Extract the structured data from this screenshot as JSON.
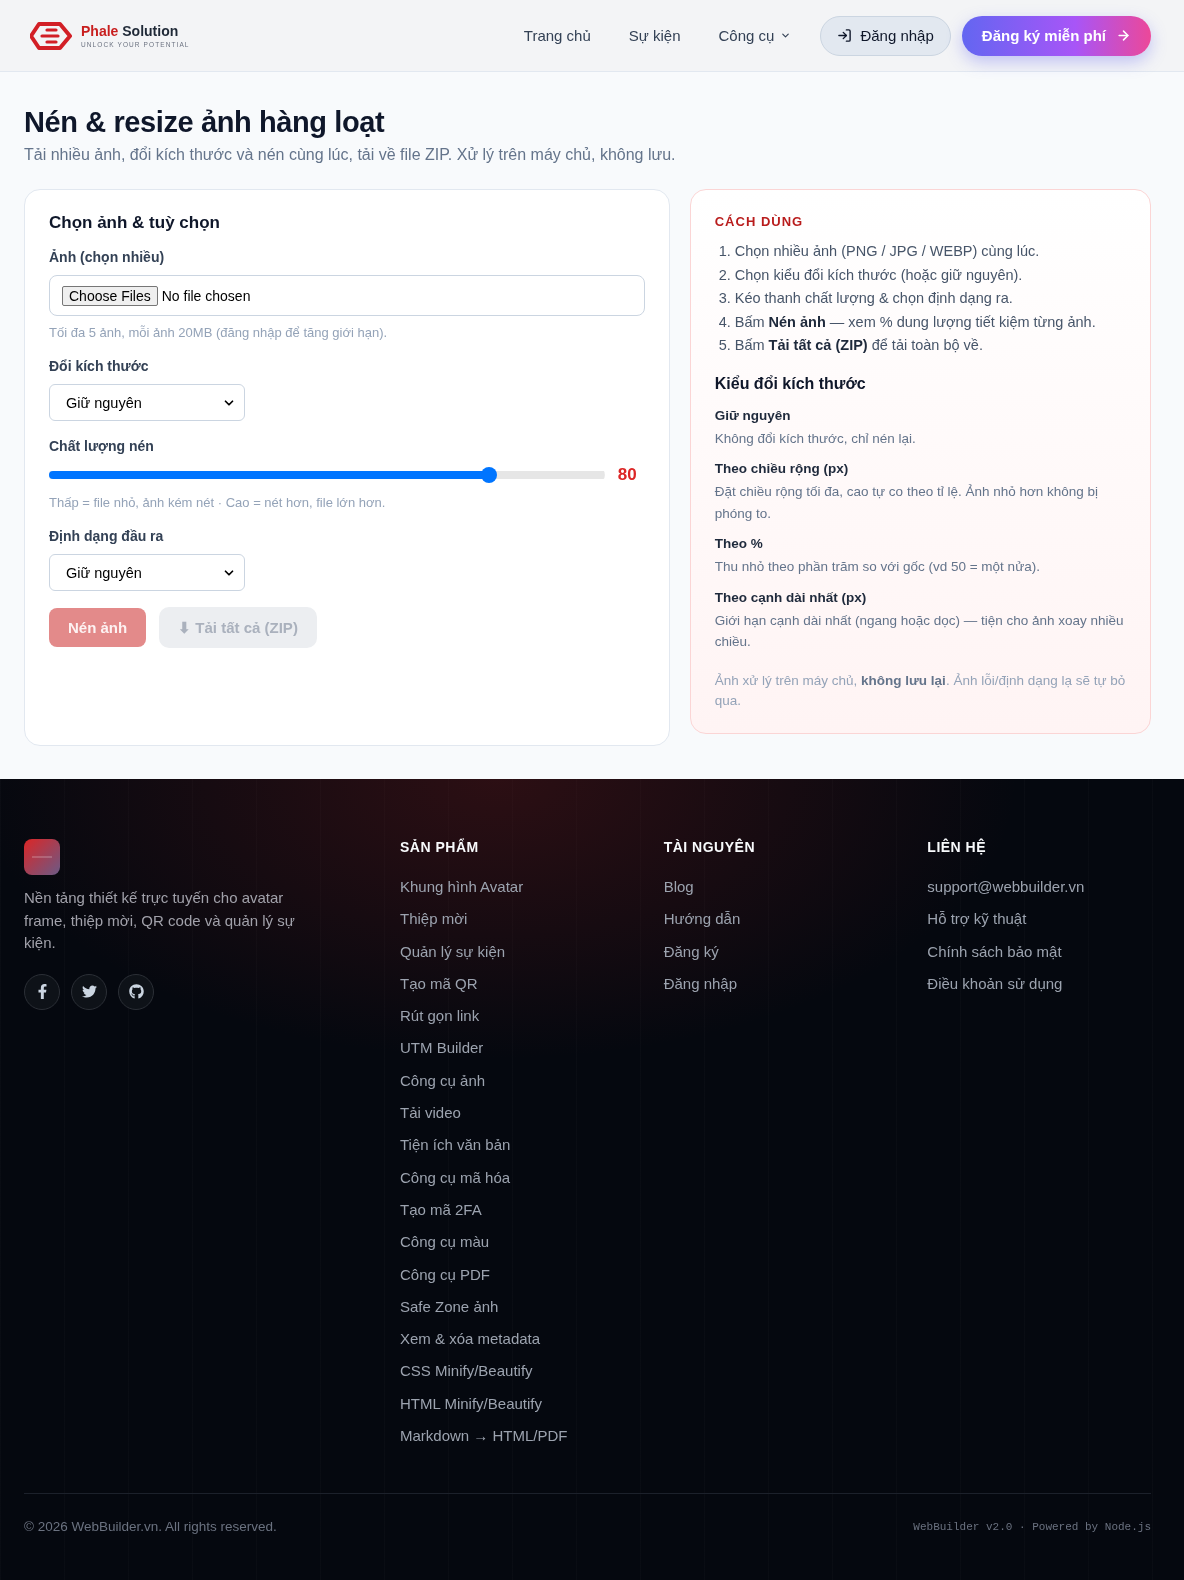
{
  "header": {
    "logo": {
      "name": "Phale",
      "suffix": "Solution",
      "tagline": "UNLOCK YOUR POTENTIAL"
    },
    "nav": [
      {
        "label": "Trang chủ",
        "kind": "link"
      },
      {
        "label": "Sự kiện",
        "kind": "link"
      },
      {
        "label": "Công cụ",
        "kind": "dropdown"
      }
    ],
    "login_button": "Đăng nhập",
    "signup_button": "Đăng ký miễn phí"
  },
  "page": {
    "title": "Nén & resize ảnh hàng loạt",
    "subtitle": "Tải nhiều ảnh, đổi kích thước và nén cùng lúc, tải về file ZIP. Xử lý trên máy chủ, không lưu."
  },
  "options_card": {
    "title": "Chọn ảnh & tuỳ chọn",
    "fields": [
      {
        "kind": "file",
        "label": "Ảnh (chọn nhiều)",
        "button": "Choose Files",
        "value": "No file chosen",
        "hint": "Tối đa 5 ảnh, mỗi ảnh 20MB (đăng nhập để tăng giới hạn)."
      },
      {
        "kind": "select",
        "label": "Đổi kích thước",
        "value": "Giữ nguyên"
      },
      {
        "kind": "slider",
        "label": "Chất lượng nén",
        "level": 0.8,
        "reading": "80",
        "hint": "Thấp = file nhỏ, ảnh kém nét · Cao = nét hơn, file lớn hơn."
      },
      {
        "kind": "select",
        "label": "Định dạng đầu ra",
        "value": "Giữ nguyên"
      }
    ],
    "buttons": [
      {
        "kind": "primary",
        "label": "Nén ảnh",
        "disabled": true
      },
      {
        "kind": "secondary",
        "label": "⬇ Tải tất cả (ZIP)",
        "disabled": true
      }
    ]
  },
  "usage_card": {
    "heading": "CÁCH DÙNG",
    "steps": [
      {
        "number": "1.",
        "text": "Chọn nhiều ảnh (PNG / JPG / WEBP) cùng lúc."
      },
      {
        "number": "2.",
        "text": "Chọn kiểu đổi kích thước (hoặc giữ nguyên)."
      },
      {
        "number": "3.",
        "text": "Kéo thanh chất lượng & chọn định dạng ra."
      },
      {
        "number": "4.",
        "text": "Bấm **Nén ảnh** — xem % dung lượng tiết kiệm từng ảnh."
      },
      {
        "number": "5.",
        "text": "Bấm **Tải tất cả (ZIP)** để tải toàn bộ về."
      }
    ],
    "modes_title": "Kiểu đổi kích thước",
    "modes": [
      {
        "name": "Giữ nguyên",
        "description": "Không đổi kích thước, chỉ nén lại."
      },
      {
        "name": "Theo chiều rộng (px)",
        "description": "Đặt chiều rộng tối đa, cao tự co theo tỉ lệ. Ảnh nhỏ hơn không bị phóng to."
      },
      {
        "name": "Theo %",
        "description": "Thu nhỏ theo phần trăm so với gốc (vd 50 = một nửa)."
      },
      {
        "name": "Theo cạnh dài nhất (px)",
        "description": "Giới hạn cạnh dài nhất (ngang hoặc dọc) — tiện cho ảnh xoay nhiều chiều."
      }
    ],
    "note": "Ảnh xử lý trên máy chủ, **không lưu lại**. Ảnh lỗi/định dạng lạ sẽ tự bỏ qua."
  },
  "footer": {
    "description": "Nền tảng thiết kế trực tuyến cho avatar frame, thiệp mời, QR code và quản lý sự kiện.",
    "columns": [
      {
        "title": "SẢN PHẨM",
        "links": [
          "Khung hình Avatar",
          "Thiệp mời",
          "Quản lý sự kiện",
          "Tạo mã QR",
          "Rút gọn link",
          "UTM Builder",
          "Công cụ ảnh",
          "Tải video",
          "Tiện ích văn bản",
          "Công cụ mã hóa",
          "Tạo mã 2FA",
          "Công cụ màu",
          "Công cụ PDF",
          "Safe Zone ảnh",
          "Xem & xóa metadata",
          "CSS Minify/Beautify",
          "HTML Minify/Beautify",
          "Markdown → HTML/PDF"
        ]
      },
      {
        "title": "TÀI NGUYÊN",
        "links": [
          "Blog",
          "Hướng dẫn",
          "Đăng ký",
          "Đăng nhập"
        ]
      },
      {
        "title": "LIÊN HỆ",
        "links": [
          "support@webbuilder.vn",
          "Hỗ trợ kỹ thuật",
          "Chính sách bảo mật",
          "Điều khoản sử dụng"
        ]
      }
    ],
    "copyright": "© 2026 WebBuilder.vn. All rights reserved.",
    "version": "WebBuilder v2.0 · Powered by Node.js"
  }
}
